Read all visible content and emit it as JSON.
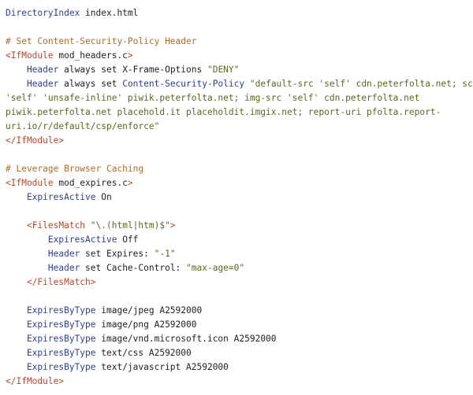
{
  "editor": {
    "background": "#ffffff",
    "colors": {
      "directive": "#2b3f8f",
      "comment": "#b06b2c",
      "tag": "#b8452a",
      "string": "#5d6620",
      "plain": "#222222"
    },
    "lines": [
      [
        [
          "directive",
          "DirectoryIndex"
        ],
        [
          "plain",
          " index.html"
        ]
      ],
      [],
      [
        [
          "comment",
          "# Set Content-Security-Policy Header"
        ]
      ],
      [
        [
          "tag",
          "<IfModule"
        ],
        [
          "plain",
          " mod_headers.c"
        ],
        [
          "tag",
          ">"
        ]
      ],
      [
        [
          "plain",
          "    "
        ],
        [
          "directive",
          "Header"
        ],
        [
          "plain",
          " always set X-Frame-Options "
        ],
        [
          "string",
          "\"DENY\""
        ]
      ],
      [
        [
          "plain",
          "    "
        ],
        [
          "directive",
          "Header"
        ],
        [
          "plain",
          " always set "
        ],
        [
          "directive",
          "Content-Security-Policy"
        ],
        [
          "plain",
          " "
        ],
        [
          "string",
          "\"default-src 'self' cdn.peterfolta.net; script-src"
        ]
      ],
      [
        [
          "string",
          "'self' 'unsafe-inline' piwik.peterfolta.net; img-src 'self' cdn.peterfolta.net"
        ]
      ],
      [
        [
          "string",
          "piwik.peterfolta.net placehold.it placeholdit.imgix.net; report-uri pfolta.report-"
        ]
      ],
      [
        [
          "string",
          "uri.io/r/default/csp/enforce\""
        ]
      ],
      [
        [
          "tag",
          "</IfModule>"
        ]
      ],
      [],
      [
        [
          "comment",
          "# Leverage Browser Caching"
        ]
      ],
      [
        [
          "tag",
          "<IfModule"
        ],
        [
          "plain",
          " mod_expires.c"
        ],
        [
          "tag",
          ">"
        ]
      ],
      [
        [
          "plain",
          "    "
        ],
        [
          "directive",
          "ExpiresActive"
        ],
        [
          "plain",
          " On"
        ]
      ],
      [],
      [
        [
          "plain",
          "    "
        ],
        [
          "tag",
          "<FilesMatch"
        ],
        [
          "plain",
          " "
        ],
        [
          "string",
          "\"\\.(html|htm)$\""
        ],
        [
          "tag",
          ">"
        ]
      ],
      [
        [
          "plain",
          "        "
        ],
        [
          "directive",
          "ExpiresActive"
        ],
        [
          "plain",
          " Off"
        ]
      ],
      [
        [
          "plain",
          "        "
        ],
        [
          "directive",
          "Header"
        ],
        [
          "plain",
          " set Expires: "
        ],
        [
          "string",
          "\"-1\""
        ]
      ],
      [
        [
          "plain",
          "        "
        ],
        [
          "directive",
          "Header"
        ],
        [
          "plain",
          " set Cache-Control: "
        ],
        [
          "string",
          "\"max-age=0\""
        ]
      ],
      [
        [
          "plain",
          "    "
        ],
        [
          "tag",
          "</FilesMatch>"
        ]
      ],
      [],
      [
        [
          "plain",
          "    "
        ],
        [
          "directive",
          "ExpiresByType"
        ],
        [
          "plain",
          " image/jpeg A2592000"
        ]
      ],
      [
        [
          "plain",
          "    "
        ],
        [
          "directive",
          "ExpiresByType"
        ],
        [
          "plain",
          " image/png A2592000"
        ]
      ],
      [
        [
          "plain",
          "    "
        ],
        [
          "directive",
          "ExpiresByType"
        ],
        [
          "plain",
          " image/vnd.microsoft.icon A2592000"
        ]
      ],
      [
        [
          "plain",
          "    "
        ],
        [
          "directive",
          "ExpiresByType"
        ],
        [
          "plain",
          " text/css A2592000"
        ]
      ],
      [
        [
          "plain",
          "    "
        ],
        [
          "directive",
          "ExpiresByType"
        ],
        [
          "plain",
          " text/javascript A2592000"
        ]
      ],
      [
        [
          "tag",
          "</IfModule>"
        ]
      ]
    ]
  }
}
